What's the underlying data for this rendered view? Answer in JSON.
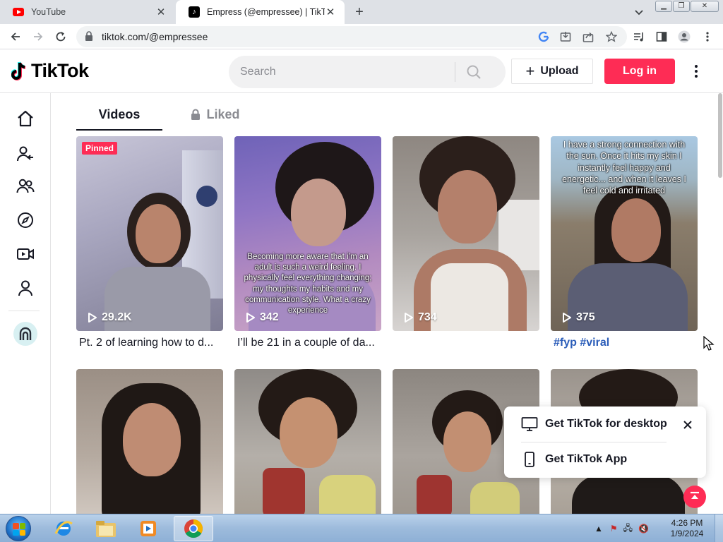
{
  "browser": {
    "tabs": [
      {
        "title": "YouTube",
        "active": false
      },
      {
        "title": "Empress (@empressee) | TikTok",
        "active": true
      }
    ],
    "new_tab": "+",
    "url": "tiktok.com/@empressee"
  },
  "tiktok": {
    "logo_text": "TikTok",
    "search": {
      "placeholder": "Search"
    },
    "upload_label": "Upload",
    "login_label": "Log in",
    "profile_tabs": {
      "videos": "Videos",
      "liked": "Liked"
    },
    "videos": [
      {
        "views": "29.2K",
        "pinned_label": "Pinned",
        "caption": "Pt. 2 of learning how to d...",
        "overlay": ""
      },
      {
        "views": "342",
        "caption": "I’ll be 21 in a couple of da...",
        "overlay": "Becoming more aware that i’m an adult is such a weird feeling. I physically feel everything changing; my thoughts my habits and my communication style. What a crazy experience"
      },
      {
        "views": "734",
        "caption": "",
        "overlay": ""
      },
      {
        "views": "375",
        "caption_tags": [
          "#fyp",
          "#viral"
        ],
        "overlay": "I have a strong connection with the sun. Once it hits my skin I instantly feel happy and energetic... and when it leaves I feel cold and irritated"
      }
    ],
    "popup": {
      "desktop_label": "Get TikTok for desktop",
      "app_label": "Get TikTok App"
    },
    "colors": {
      "brand": "#fe2c55",
      "hashtag": "#2b5db9"
    }
  },
  "taskbar": {
    "time": "4:26 PM",
    "date": "1/9/2024"
  }
}
